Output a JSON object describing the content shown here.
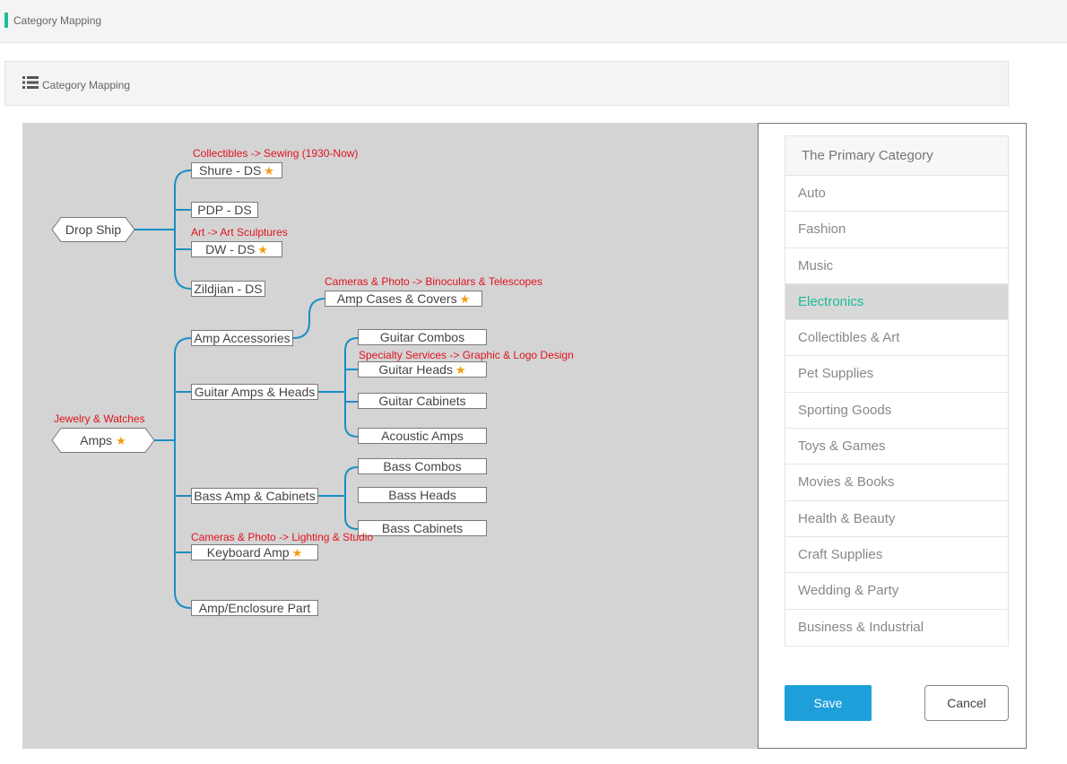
{
  "topbar": {
    "title": "Category Mapping"
  },
  "panel": {
    "title": "Category Mapping",
    "icon": "list-icon"
  },
  "tree": {
    "roots": [
      {
        "label": "Drop Ship"
      },
      {
        "label": "Amps",
        "note": "Jewelry & Watches",
        "starred": true
      }
    ],
    "nodes": [
      {
        "label": "Shure - DS",
        "note": "Collectibles -> Sewing (1930-Now)",
        "starred": true
      },
      {
        "label": "PDP - DS"
      },
      {
        "label": "DW - DS",
        "note": "Art -> Art Sculptures",
        "starred": true
      },
      {
        "label": "Zildjian - DS"
      },
      {
        "label": "Amp Accessories"
      },
      {
        "label": "Amp Cases & Covers",
        "note": "Cameras & Photo -> Binoculars & Telescopes",
        "starred": true
      },
      {
        "label": "Guitar Amps & Heads"
      },
      {
        "label": "Guitar Combos"
      },
      {
        "label": "Guitar Heads",
        "note": "Specialty Services -> Graphic & Logo Design",
        "starred": true
      },
      {
        "label": "Guitar Cabinets"
      },
      {
        "label": "Acoustic Amps"
      },
      {
        "label": "Bass Amp & Cabinets"
      },
      {
        "label": "Bass Combos"
      },
      {
        "label": "Bass Heads"
      },
      {
        "label": "Bass Cabinets"
      },
      {
        "label": "Keyboard Amp",
        "note": "Cameras & Photo -> Lighting & Studio",
        "starred": true
      },
      {
        "label": "Amp/Enclosure Part"
      }
    ]
  },
  "categories": {
    "header": "The Primary Category",
    "items": [
      "Auto",
      "Fashion",
      "Music",
      "Electronics",
      "Collectibles & Art",
      "Pet Supplies",
      "Sporting Goods",
      "Toys & Games",
      "Movies & Books",
      "Health & Beauty",
      "Craft Supplies",
      "Wedding & Party",
      "Business & Industrial"
    ],
    "selected": "Electronics"
  },
  "actions": {
    "save": "Save",
    "cancel": "Cancel"
  },
  "colors": {
    "accent": "#1abc9c",
    "link": "#1e9fd9",
    "note": "#e0141e",
    "star": "#f39c12"
  }
}
